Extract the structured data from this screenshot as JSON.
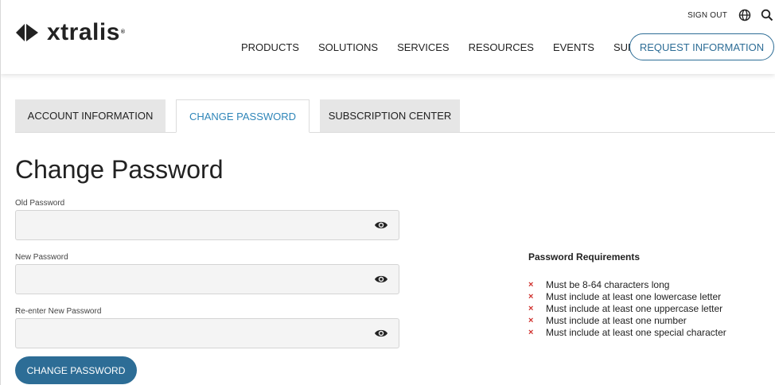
{
  "header": {
    "logo_text": "xtralis",
    "logo_reg": "®",
    "sign_out": "SIGN OUT",
    "nav": [
      "PRODUCTS",
      "SOLUTIONS",
      "SERVICES",
      "RESOURCES",
      "EVENTS",
      "SUPPORT"
    ],
    "request_button": "REQUEST INFORMATION"
  },
  "tabs": [
    {
      "label": "ACCOUNT INFORMATION",
      "active": false
    },
    {
      "label": "CHANGE PASSWORD",
      "active": true
    },
    {
      "label": "SUBSCRIPTION CENTER",
      "active": false
    }
  ],
  "page_title": "Change Password",
  "form": {
    "old_password": {
      "label": "Old Password",
      "value": ""
    },
    "new_password": {
      "label": "New Password",
      "value": ""
    },
    "reenter_password": {
      "label": "Re-enter New Password",
      "value": ""
    },
    "submit_label": "CHANGE PASSWORD"
  },
  "requirements": {
    "title": "Password Requirements",
    "marker": "×",
    "items": [
      "Must be 8-64 characters long",
      "Must include at least one lowercase letter",
      "Must include at least one uppercase letter",
      "Must include at least one number",
      "Must include at least one special character"
    ]
  },
  "colors": {
    "brand_blue": "#2d6d96",
    "active_tab_text": "#2f86b9",
    "requirement_unmet": "#d0312d"
  },
  "icons": [
    "globe-icon",
    "search-icon",
    "eye-icon"
  ]
}
